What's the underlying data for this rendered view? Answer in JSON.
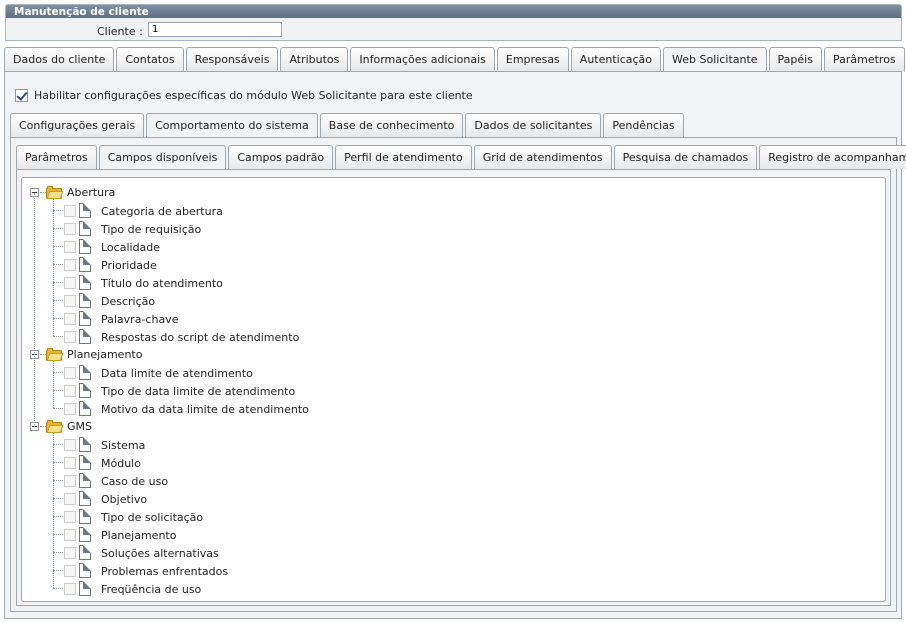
{
  "window": {
    "title": "Manutenção de cliente",
    "client_label": "Cliente :",
    "client_value": "1"
  },
  "main_tabs": [
    {
      "label": "Dados do cliente",
      "active": false
    },
    {
      "label": "Contatos",
      "active": false
    },
    {
      "label": "Responsáveis",
      "active": false
    },
    {
      "label": "Atributos",
      "active": false
    },
    {
      "label": "Informações adicionais",
      "active": false
    },
    {
      "label": "Empresas",
      "active": false
    },
    {
      "label": "Autenticação",
      "active": false
    },
    {
      "label": "Web Solicitante",
      "active": true
    },
    {
      "label": "Papéis",
      "active": false
    },
    {
      "label": "Parâmetros",
      "active": false
    }
  ],
  "enable_checkbox": {
    "label": "Habilitar configurações específicas do módulo Web Solicitante para este cliente",
    "checked": true
  },
  "sub_tabs": [
    {
      "label": "Configurações gerais",
      "active": false
    },
    {
      "label": "Comportamento do sistema",
      "active": true
    },
    {
      "label": "Base de conhecimento",
      "active": false
    },
    {
      "label": "Dados de solicitantes",
      "active": false
    },
    {
      "label": "Pendências",
      "active": false
    }
  ],
  "sub2_tabs": [
    {
      "label": "Parâmetros",
      "active": false
    },
    {
      "label": "Campos disponíveis",
      "active": true
    },
    {
      "label": "Campos padrão",
      "active": false
    },
    {
      "label": "Perfil de atendimento",
      "active": false
    },
    {
      "label": "Grid de atendimentos",
      "active": false
    },
    {
      "label": "Pesquisa de chamados",
      "active": false
    },
    {
      "label": "Registro de acompanhamentos",
      "active": false
    }
  ],
  "tree": [
    {
      "label": "Abertura",
      "icon": "folder-open-icon",
      "items": [
        "Categoria de abertura",
        "Tipo de requisição",
        "Localidade",
        "Prioridade",
        "Título do atendimento",
        "Descrição",
        "Palavra-chave",
        "Respostas do script de atendimento"
      ]
    },
    {
      "label": "Planejamento",
      "icon": "folder-open-icon",
      "items": [
        "Data limite de atendimento",
        "Tipo de data limite de atendimento",
        "Motivo da data limite de atendimento"
      ]
    },
    {
      "label": "GMS",
      "icon": "folder-open-icon",
      "items": [
        "Sistema",
        "Módulo",
        "Caso de uso",
        "Objetivo",
        "Tipo de solicitação",
        "Planejamento",
        "Soluções alternativas",
        "Problemas enfrentados",
        "Freqüência de uso"
      ]
    }
  ]
}
